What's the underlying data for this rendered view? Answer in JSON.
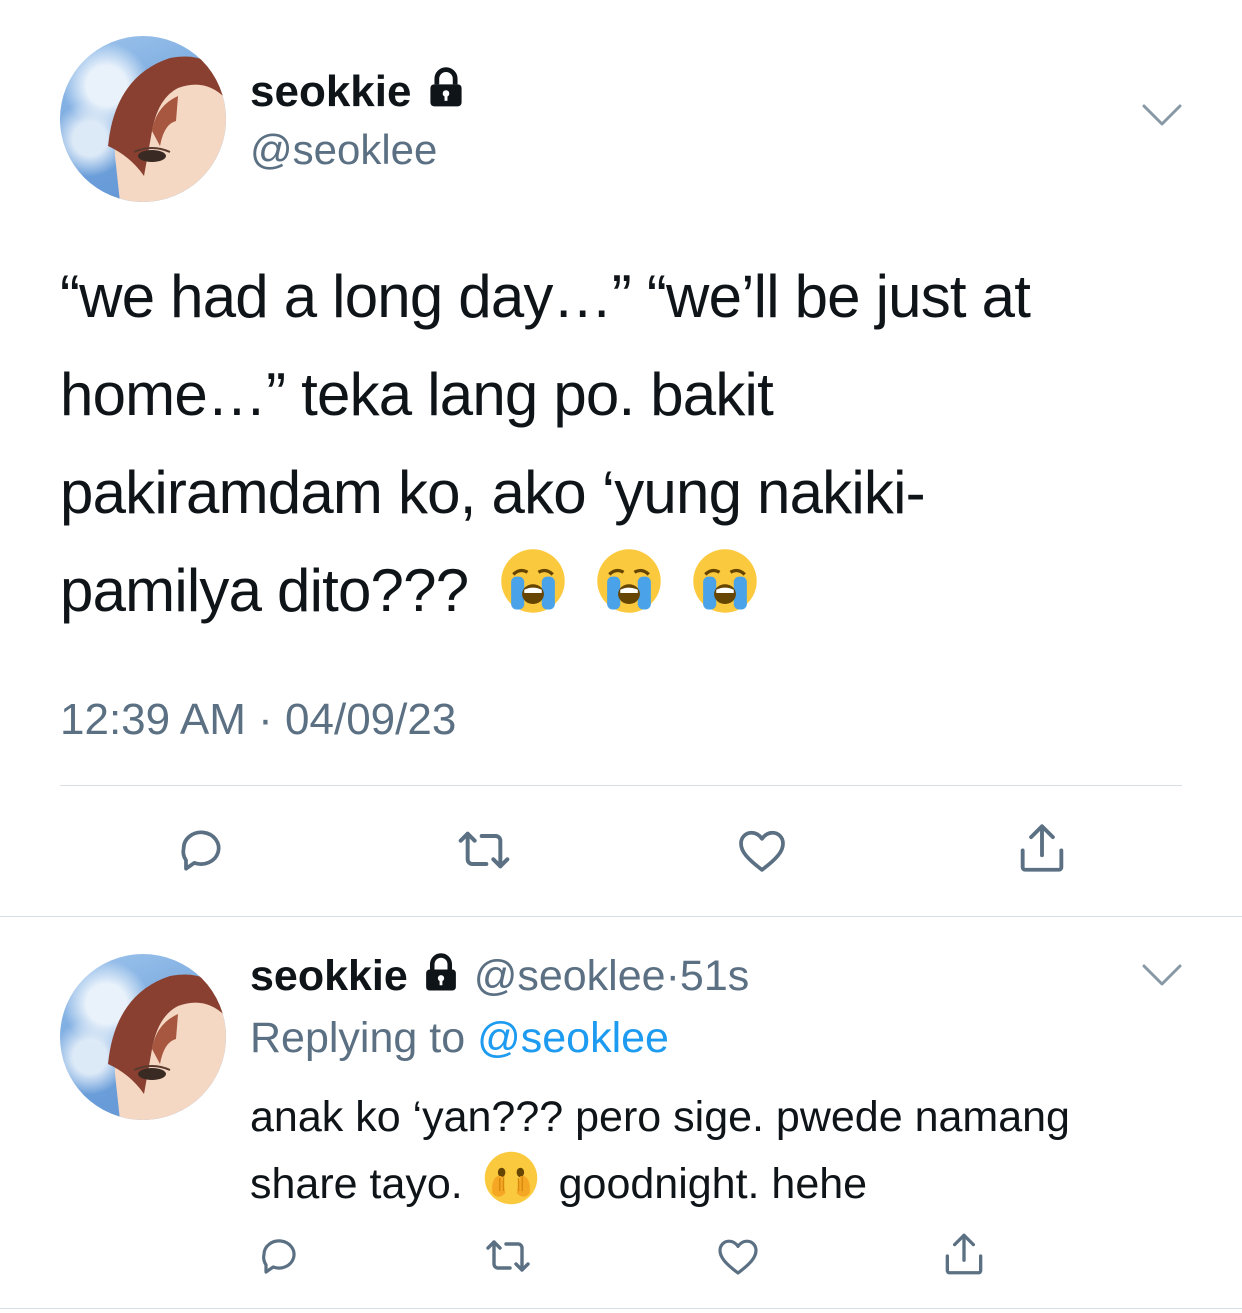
{
  "main_tweet": {
    "display_name": "seokkie",
    "handle": "@seoklee",
    "text_lines": [
      "“we had a long day…” “we’ll be just at",
      "home…” teka lang po. bakit",
      "pakiramdam ko, ako ‘yung nakiki-",
      "pamilya dito???"
    ],
    "emojis": [
      "loudly-crying-face",
      "loudly-crying-face",
      "loudly-crying-face"
    ],
    "time": "12:39 AM",
    "separator": "·",
    "date": "04/09/23"
  },
  "reply": {
    "display_name": "seokkie",
    "handle": "@seoklee",
    "separator": "·",
    "age": "51s",
    "replying_prefix": "Replying to",
    "replying_to": "@seoklee",
    "text_line1": "anak ko ‘yan??? pero sige. pwede namang",
    "text_line2_a": "share tayo.",
    "text_line2_b": "goodnight. hehe",
    "emoji": "face-with-open-eyes-and-hand-over-mouth"
  },
  "icons": {
    "lock": "lock-icon",
    "chevron": "chevron-down-icon",
    "reply": "reply-icon",
    "retweet": "retweet-icon",
    "like": "heart-icon",
    "share": "share-icon"
  },
  "colors": {
    "text": "#0f1419",
    "secondary": "#5b7083",
    "link": "#1d9bf0",
    "divider": "#d8dee3",
    "icon": "#5b7083"
  }
}
